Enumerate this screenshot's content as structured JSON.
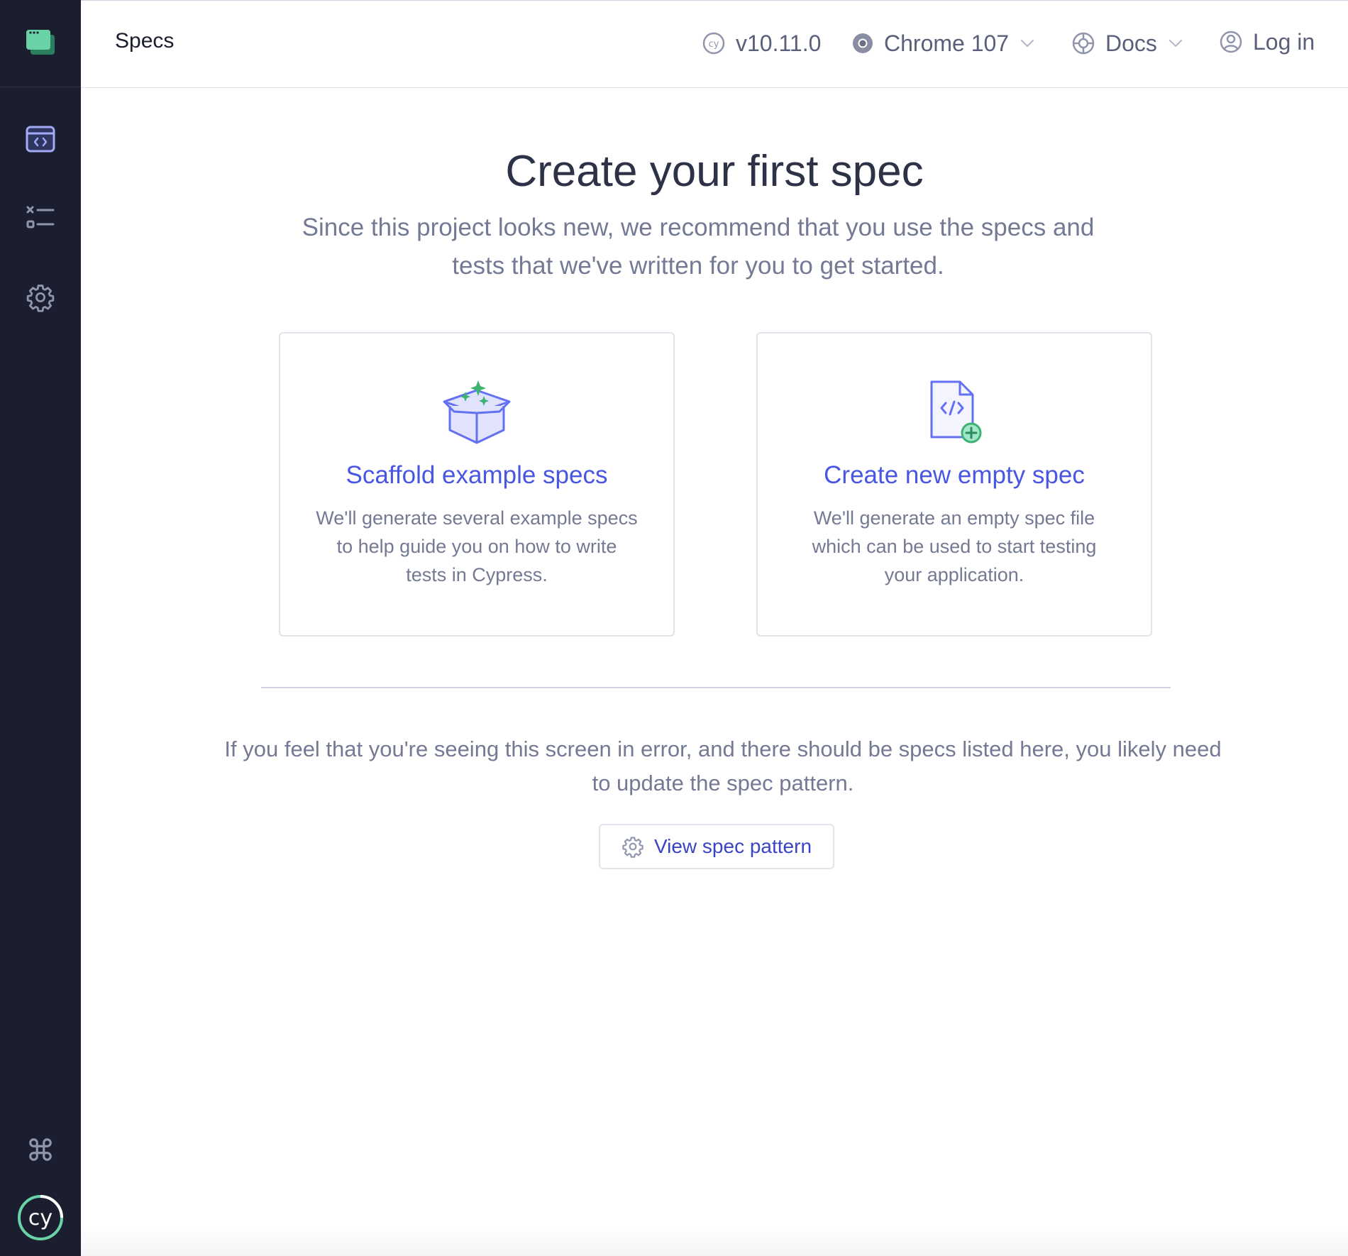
{
  "header": {
    "title": "Specs",
    "version": "v10.11.0",
    "browser": "Chrome 107",
    "docs": "Docs",
    "login": "Log in"
  },
  "sidebar": {
    "items": [
      {
        "name": "specs",
        "icon": "code-window-icon",
        "active": true
      },
      {
        "name": "runs",
        "icon": "test-list-icon",
        "active": false
      },
      {
        "name": "settings",
        "icon": "gear-icon",
        "active": false
      }
    ],
    "bottom": [
      {
        "name": "keyboard-shortcuts",
        "icon": "command-key-icon"
      },
      {
        "name": "cypress-logo",
        "icon": "cypress-logo-icon"
      }
    ]
  },
  "main": {
    "title": "Create your first spec",
    "subtitle": "Since this project looks new, we recommend that you use the specs and tests that we've written for you to get started.",
    "cards": [
      {
        "title": "Scaffold example specs",
        "description": "We'll generate several example specs to help guide you on how to write tests in Cypress.",
        "icon": "sparkle-box-icon"
      },
      {
        "title": "Create new empty spec",
        "description": "We'll generate an empty spec file which can be used to start testing your application.",
        "icon": "new-code-file-icon"
      }
    ],
    "error_message": "If you feel that you're seeing this screen in error, and there should be specs listed here, you likely need to update the spec pattern.",
    "view_pattern_label": "View spec pattern"
  },
  "colors": {
    "sidebar_bg": "#1b1e2e",
    "accent": "#4956e3",
    "green": "#3cb371",
    "muted_text": "#747994"
  }
}
